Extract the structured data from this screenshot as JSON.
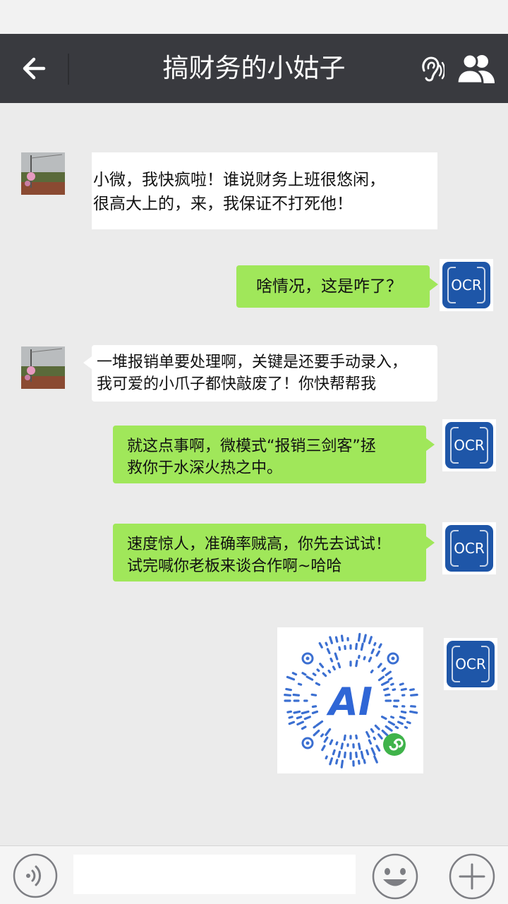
{
  "header": {
    "title": "搞财务的小姑子",
    "back_icon": "arrow-left-icon",
    "ear_icon": "ear-icon",
    "people_icon": "group-profile-icon",
    "bar_color": "#393a3f"
  },
  "messages": [
    {
      "side": "left",
      "lines": [
        "小微，我快疯啦！谁说财务上班很悠闲，",
        "很高大上的，来，我保证不打死他！"
      ]
    },
    {
      "side": "right",
      "lines": [
        "啥情况，这是咋了？"
      ]
    },
    {
      "side": "left",
      "lines": [
        "一堆报销单要处理啊，关键是还要手动录入，",
        "我可爱的小爪子都快敲废了！你快帮帮我"
      ]
    },
    {
      "side": "right",
      "lines": [
        "就这点事啊，微模式“报销三剑客”拯",
        "救你于水深火热之中。"
      ]
    },
    {
      "side": "right",
      "lines": [
        "速度惊人，准确率贼高，你先去试试！",
        "试完喊你老板来谈合作啊~哈哈"
      ]
    },
    {
      "side": "right",
      "type": "image",
      "label": "AI",
      "icon": "mini-program-qr-code"
    }
  ],
  "ocr_avatar": {
    "label": "OCR",
    "color": "#1e56a8"
  },
  "colors": {
    "sent_bubble": "#a0e75a",
    "received_bubble": "#ffffff",
    "background": "#ebebeb"
  },
  "input": {
    "value": "",
    "placeholder": ""
  },
  "toolbar": {
    "voice_icon": "voice-input-icon",
    "emoji_icon": "emoji-icon",
    "plus_icon": "plus-icon"
  }
}
